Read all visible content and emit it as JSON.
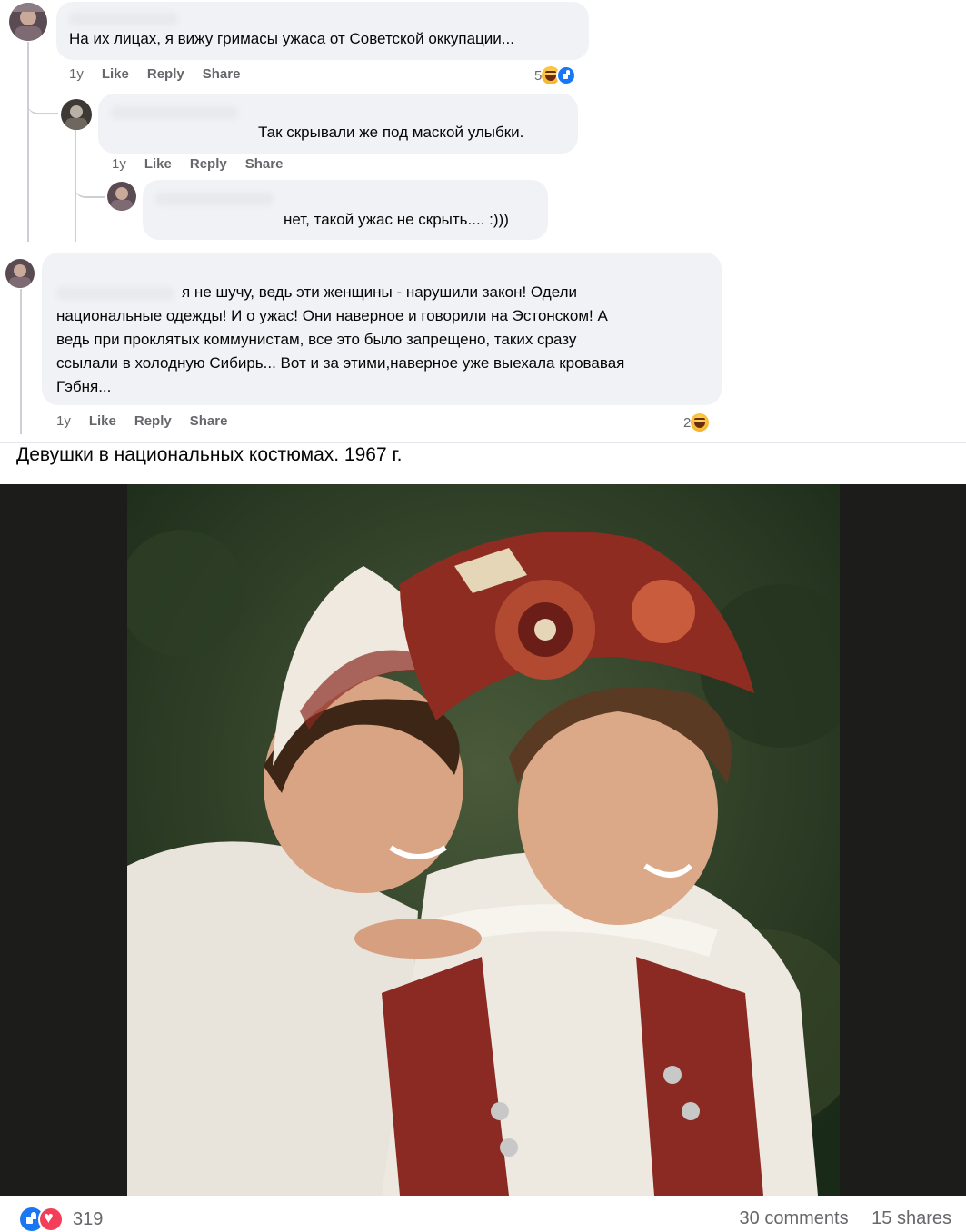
{
  "comments": [
    {
      "text": "На их лицах, я вижу гримасы ужаса от Советской оккупации...",
      "time": "1y",
      "like": "Like",
      "reply": "Reply",
      "share": "Share",
      "reaction_count": "5"
    },
    {
      "text": "Так скрывали же под маской улыбки.",
      "time": "1y",
      "like": "Like",
      "reply": "Reply",
      "share": "Share"
    },
    {
      "text": "нет, такой ужас не скрыть.... :)))"
    },
    {
      "text_lines": [
        "я не шучу, ведь эти женщины - нарушили закон! Одели",
        "национальные одежды! И о ужас! Они наверное и говорили на Эстонском! А",
        "ведь при проклятых коммунистам, все это было запрещено, таких сразу",
        "ссылали в холодную Сибирь... Вот и за этими,наверное уже выехала кровавая",
        "Гэбня..."
      ],
      "time": "1y",
      "like": "Like",
      "reply": "Reply",
      "share": "Share",
      "reaction_count": "2"
    }
  ],
  "post": {
    "caption": "Девушки в национальных костюмах. 1967 г.",
    "reactions_count": "319",
    "comments_count": "30 comments",
    "shares_count": "15 shares"
  },
  "colors": {
    "bubble": "#f0f2f5",
    "meta_text": "#65676b",
    "like_blue": "#1877f2",
    "love_red": "#f33e58",
    "haha_yellow": "#f7b125"
  }
}
